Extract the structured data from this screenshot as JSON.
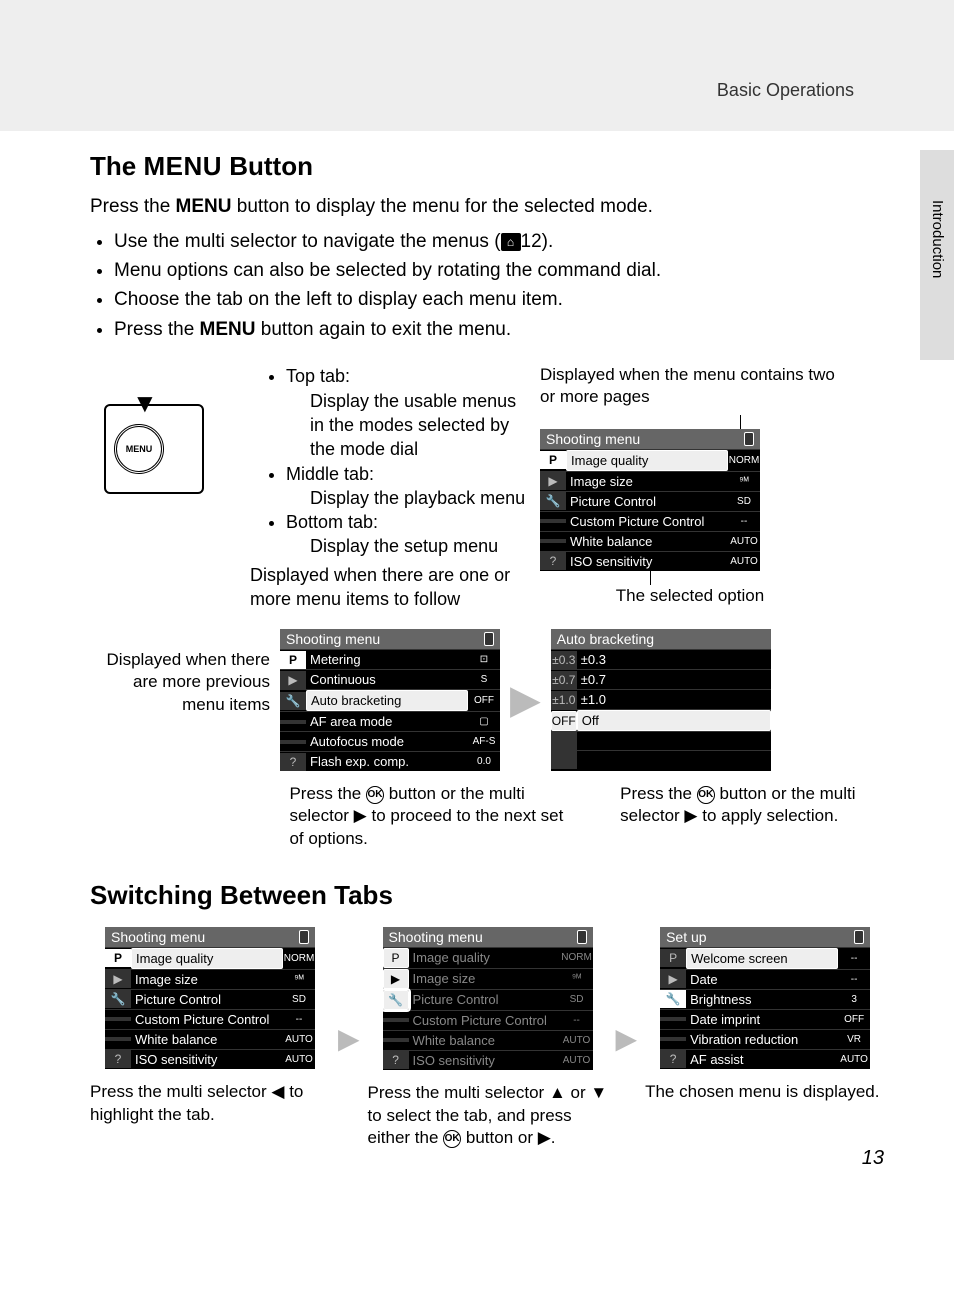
{
  "header": "Basic Operations",
  "sideLabel": "Introduction",
  "pageNumber": "13",
  "h1_a": "The ",
  "h1_menu": "MENU",
  "h1_b": " Button",
  "intro_a": "Press the ",
  "intro_b": " button to display the menu for the selected mode.",
  "bullets": {
    "b1_a": "Use the multi selector to navigate the menus (",
    "b1_b": "12).",
    "b2": "Menu options can also be selected by rotating the command dial.",
    "b3": "Choose the tab on the left to display each menu item.",
    "b4_a": "Press the ",
    "b4_b": " button again to exit the menu."
  },
  "tabs": {
    "top": "Top tab:",
    "topDesc": "Display the usable menus in the modes selected by the mode dial",
    "mid": "Middle tab:",
    "midDesc": "Display the playback menu",
    "bot": "Bottom tab:",
    "botDesc": "Display the setup menu",
    "follow": "Displayed when there are one or more menu items to follow"
  },
  "callouts": {
    "pages": "Displayed when the menu contains two or more pages",
    "selected": "The selected option",
    "prev": "Displayed when there are more previous menu items"
  },
  "lcd1": {
    "title": "Shooting menu",
    "r1": "Image quality",
    "v1": "NORM",
    "r2": "Image size",
    "v2": "⁹ᴹ",
    "r3": "Picture Control",
    "v3": "SD",
    "r4": "Custom Picture Control",
    "v4": "--",
    "r5": "White balance",
    "v5": "AUTO",
    "r6": "ISO sensitivity",
    "v6": "AUTO"
  },
  "lcd2": {
    "title": "Shooting menu",
    "r1": "Metering",
    "v1": "⊡",
    "r2": "Continuous",
    "v2": "S",
    "r3": "Auto bracketing",
    "v3": "OFF",
    "r4": "AF area mode",
    "v4": "▢",
    "r5": "Autofocus mode",
    "v5": "AF-S",
    "r6": "Flash exp. comp.",
    "v6": "0.0"
  },
  "lcd3": {
    "title": "Auto bracketing",
    "r1a": "±0.3",
    "r1b": "±0.3",
    "r2a": "±0.7",
    "r2b": "±0.7",
    "r3a": "±1.0",
    "r3b": "±1.0",
    "r4a": "OFF",
    "r4b": "Off"
  },
  "cap2_a": "Press the ",
  "cap2_b": " button or the multi selector ▶ to proceed to the next set of options.",
  "cap3_a": "Press the ",
  "cap3_b": " button or the multi selector ▶ to apply selection.",
  "h2": "Switching Between Tabs",
  "switch1": "Press the multi selector ◀ to highlight the tab.",
  "switch2_a": "Press the multi selector ▲ or ▼ to select the tab, and press either the ",
  "switch2_b": " button or ▶.",
  "switch3": "The chosen menu is displayed.",
  "lcdSetup": {
    "title": "Set up",
    "r1": "Welcome screen",
    "v1": "--",
    "r2": "Date",
    "v2": "--",
    "r3": "Brightness",
    "v3": "3",
    "r4": "Date imprint",
    "v4": "OFF",
    "r5": "Vibration reduction",
    "v5": "VR",
    "r6": "AF assist",
    "v6": "AUTO"
  },
  "cameraLabel": "MENU"
}
